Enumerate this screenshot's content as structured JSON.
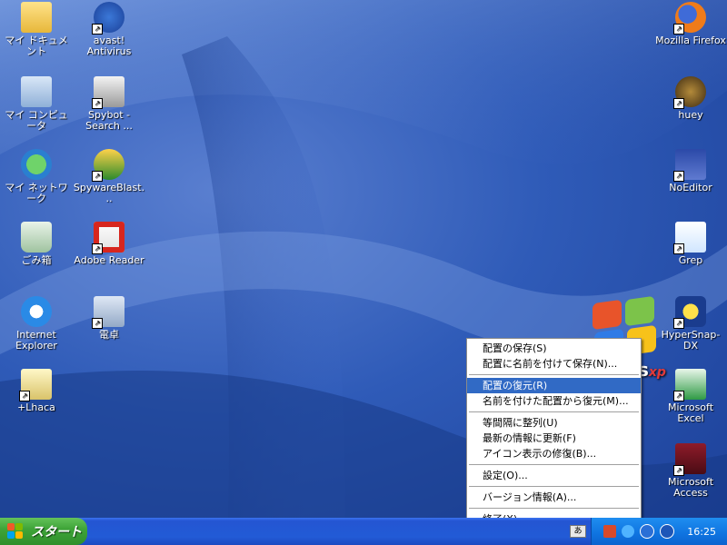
{
  "desktop": {
    "icons_left": [
      {
        "label": "マイ ドキュメント",
        "icon": "folder-icon"
      },
      {
        "label": "マイ コンピュータ",
        "icon": "computer-icon"
      },
      {
        "label": "マイ ネットワーク",
        "icon": "network-icon"
      },
      {
        "label": "ごみ箱",
        "icon": "recycle-bin-icon"
      },
      {
        "label": "Internet Explorer",
        "icon": "internet-explorer-icon"
      },
      {
        "label": "+Lhaca",
        "icon": "archive-icon"
      }
    ],
    "icons_mid": [
      {
        "label": "avast! Antivirus",
        "icon": "avast-icon"
      },
      {
        "label": "Spybot - Search ...",
        "icon": "spybot-icon"
      },
      {
        "label": "SpywareBlast...",
        "icon": "spywareblaster-icon"
      },
      {
        "label": "Adobe Reader",
        "icon": "adobe-reader-icon"
      },
      {
        "label": "電卓",
        "icon": "calculator-icon"
      }
    ],
    "icons_right": [
      {
        "label": "Mozilla Firefox",
        "icon": "firefox-icon"
      },
      {
        "label": "huey",
        "icon": "huey-icon"
      },
      {
        "label": "NoEditor",
        "icon": "noeditor-icon"
      },
      {
        "label": "Grep",
        "icon": "grep-icon"
      },
      {
        "label": "HyperSnap-DX",
        "icon": "hypersnap-icon"
      },
      {
        "label": "Microsoft Excel",
        "icon": "excel-icon"
      },
      {
        "label": "Microsoft Access",
        "icon": "access-icon"
      }
    ],
    "xp_logo": {
      "text": "s",
      "sup": "xp"
    }
  },
  "context_menu": {
    "items": [
      {
        "label": "配置の保存(S)"
      },
      {
        "label": "配置に名前を付けて保存(N)..."
      },
      {
        "label": "配置の復元(R)"
      },
      {
        "label": "名前を付けた配置から復元(M)..."
      },
      {
        "label": "等間隔に整列(U)"
      },
      {
        "label": "最新の情報に更新(F)"
      },
      {
        "label": "アイコン表示の修復(B)..."
      },
      {
        "label": "設定(O)..."
      },
      {
        "label": "バージョン情報(A)..."
      },
      {
        "label": "終了(X)"
      }
    ],
    "selected_index": 2,
    "highlight_color": "#316ac5"
  },
  "taskbar": {
    "start_label": "スタート",
    "clock": "16:25",
    "keyboard_indicator": "あ",
    "colors": {
      "start": "#3fa539",
      "bar": "#245ad6",
      "tray": "#0f73e0"
    }
  }
}
